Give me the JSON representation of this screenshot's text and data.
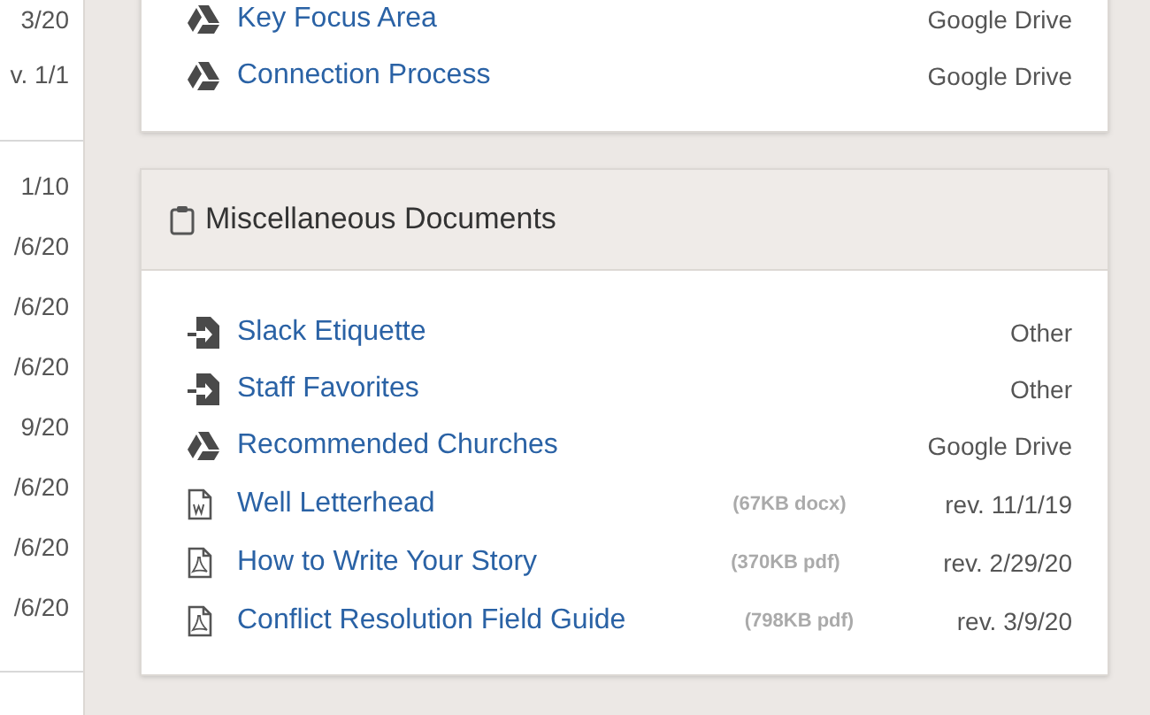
{
  "left_column": {
    "groups": [
      [
        "3/20",
        "v. 1/1"
      ],
      [
        "1/10",
        "/6/20",
        "/6/20",
        "/6/20",
        "9/20",
        "/6/20",
        "/6/20",
        "/6/20"
      ]
    ]
  },
  "top_card": {
    "items": [
      {
        "kind": "drive",
        "title": "Key Focus Area",
        "source": "Google Drive"
      },
      {
        "kind": "drive",
        "title": "Connection Process",
        "source": "Google Drive"
      }
    ]
  },
  "misc_card": {
    "title": "Miscellaneous Documents",
    "items": [
      {
        "kind": "link",
        "title": "Slack Etiquette",
        "source": "Other"
      },
      {
        "kind": "link",
        "title": "Staff Favorites",
        "source": "Other"
      },
      {
        "kind": "drive",
        "title": "Recommended Churches",
        "source": "Google Drive"
      },
      {
        "kind": "word",
        "title": "Well Letterhead",
        "size": "(67KB docx)",
        "source": "rev. 11/1/19"
      },
      {
        "kind": "pdf",
        "title": "How to Write Your Story",
        "size": "(370KB pdf)",
        "source": "rev. 2/29/20"
      },
      {
        "kind": "pdf",
        "title": "Conflict Resolution Field Guide",
        "size": "(798KB pdf)",
        "source": "rev. 3/9/20"
      }
    ]
  }
}
